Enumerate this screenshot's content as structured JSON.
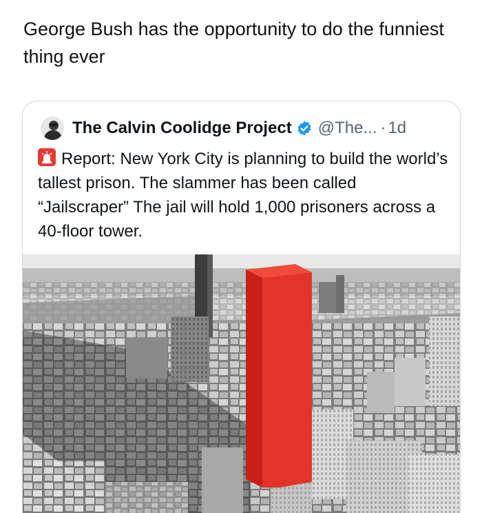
{
  "post": {
    "text": "George Bush has the opportunity to do the funniest thing ever"
  },
  "quoted_post": {
    "author_name": "The Calvin Coolidge Project",
    "handle": "@The...",
    "separator": "·",
    "time": "1d",
    "avatar_icon": "avatar-portrait",
    "verified_icon": "verified-badge-icon",
    "verified_color": "#1d9bf0",
    "emoji_icon": "police-siren-icon",
    "body": "Report: New York City is planning to build the world’s tallest prison. The slammer has been called “Jailscraper” The jail will hold 1,000 prisoners across a 40-floor tower.",
    "media": {
      "description_icon": "aerial-city-photo",
      "highlight_color": "#e3342a"
    }
  }
}
